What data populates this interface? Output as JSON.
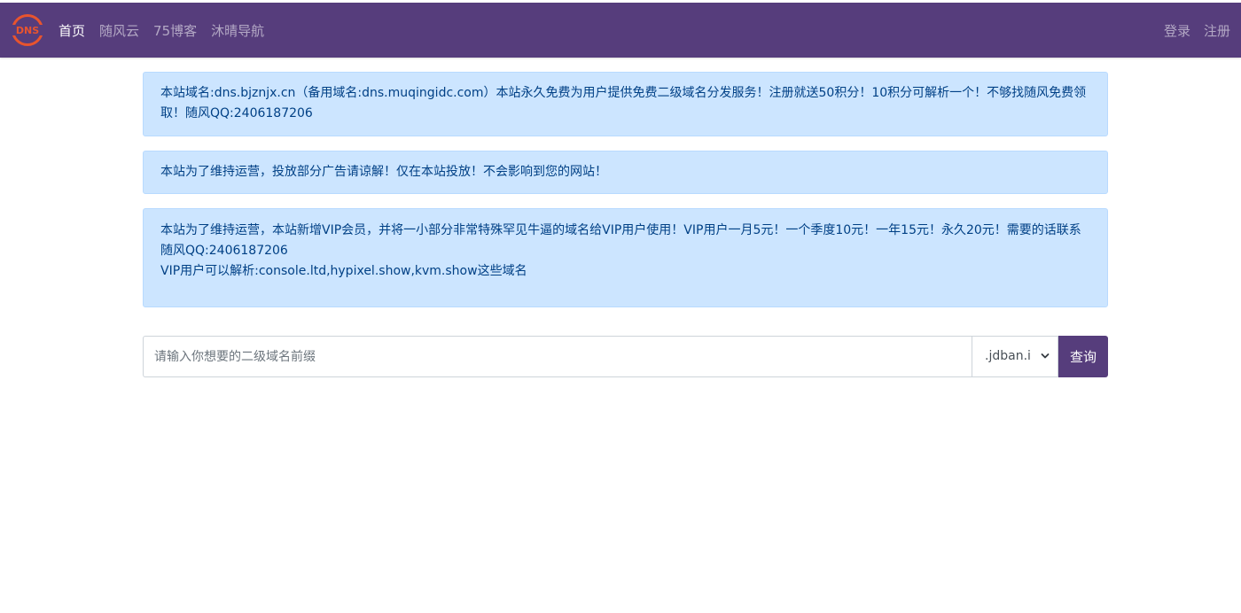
{
  "colors": {
    "brand": "#563d7c",
    "alert_bg": "#cce5ff",
    "alert_text": "#004085",
    "logo_orange": "#e8542e"
  },
  "navbar": {
    "logo": {
      "text": "DNS",
      "icon": "dns-globe-logo"
    },
    "links": [
      {
        "label": "首页",
        "active": true
      },
      {
        "label": "随风云",
        "active": false
      },
      {
        "label": "75博客",
        "active": false
      },
      {
        "label": "沐晴导航",
        "active": false
      }
    ],
    "right": {
      "login": "登录",
      "register": "注册"
    }
  },
  "alerts": {
    "notice1": "本站域名:dns.bjznjx.cn（备用域名:dns.muqingidc.com）本站永久免费为用户提供免费二级域名分发服务！注册就送50积分！10积分可解析一个！不够找随风免费领取！随风QQ:2406187206",
    "notice2": "本站为了维持运营，投放部分广告请谅解！仅在本站投放！不会影响到您的网站！",
    "notice3_line1": "本站为了维持运营，本站新增VIP会员，并将一小部分非常特殊罕见牛逼的域名给VIP用户使用！VIP用户一月5元！一个季度10元！一年15元！永久20元！需要的话联系随风QQ:2406187206",
    "notice3_line2": "VIP用户可以解析:console.ltd,hypixel.show,kvm.show这些域名"
  },
  "search": {
    "placeholder": "请输入你想要的二级域名前缀",
    "value": "",
    "suffix_selected": ".jdban.i",
    "button_label": "查询"
  }
}
